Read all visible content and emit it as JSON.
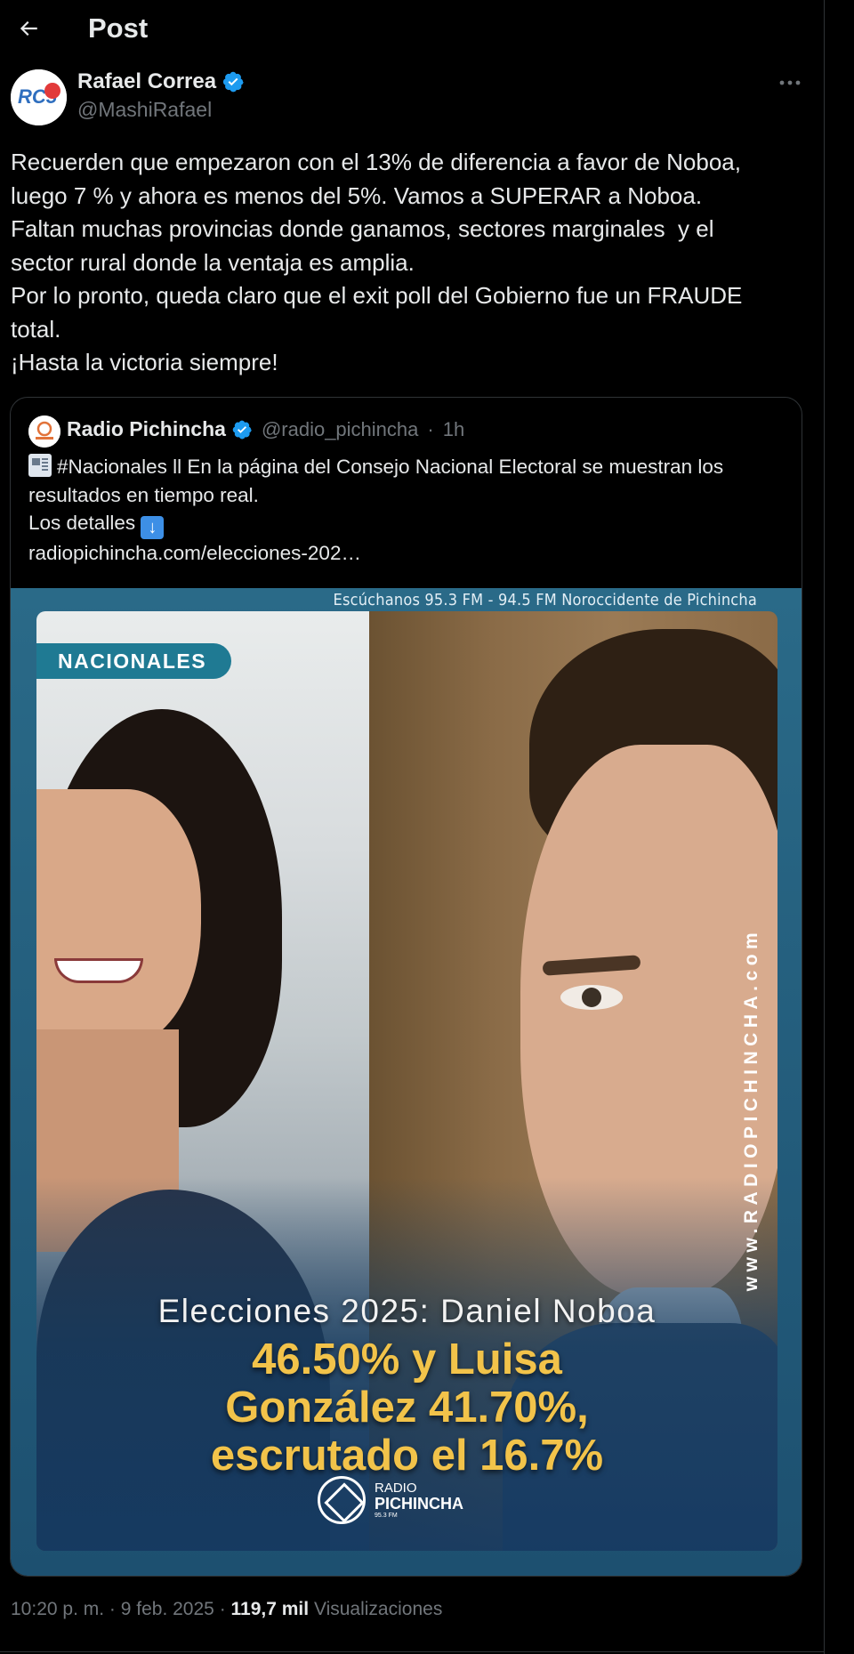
{
  "header": {
    "title": "Post"
  },
  "author": {
    "name": "Rafael Correa",
    "handle": "@MashiRafael",
    "verified": true,
    "avatar_text": "RC5"
  },
  "post": {
    "lines": [
      "Recuerden que empezaron con el 13% de diferencia a favor de Noboa,",
      "luego 7 % y ahora es menos del 5%. Vamos a SUPERAR a Noboa.",
      "Faltan muchas provincias donde ganamos, sectores marginales  y el",
      "sector rural donde la ventaja es amplia.",
      "Por lo pronto, queda claro que el exit poll del Gobierno fue un FRAUDE",
      "total.",
      "¡Hasta la victoria siempre!"
    ]
  },
  "quote": {
    "name": "Radio Pichincha",
    "handle": "@radio_pichincha",
    "separator": "·",
    "time": "1h",
    "verified": true,
    "text_line1": "#Nacionales ll En la página del Consejo Nacional Electoral se muestran los",
    "text_line2": "resultados en tiempo real.",
    "text_line3": "Los detalles",
    "link": "radiopichincha.com/elecciones-202…",
    "image": {
      "top_banner": "Escúchanos 95.3 FM - 94.5 FM Noroccidente de Pichincha",
      "badge": "NACIONALES",
      "side_url": "www.RADIOPICHINCHA.com",
      "headline_line1": "Elecciones 2025: Daniel Noboa",
      "headline_line2": "46.50% y Luisa",
      "headline_line3": "González 41.70%,",
      "headline_line4": "escrutado el 16.7%",
      "logo_line1": "RADIO",
      "logo_line2": "PICHINCHA",
      "logo_line3": "95.3 FM"
    }
  },
  "meta": {
    "time": "10:20 p. m.",
    "date": "9 feb. 2025",
    "separator": "·",
    "views_count": "119,7 mil",
    "views_label": "Visualizaciones"
  },
  "colors": {
    "background": "#000000",
    "text": "#e7e9ea",
    "muted": "#71767b",
    "verified": "#1d9bf0",
    "border": "#2f3336",
    "headline_yellow": "#f2c34a"
  }
}
